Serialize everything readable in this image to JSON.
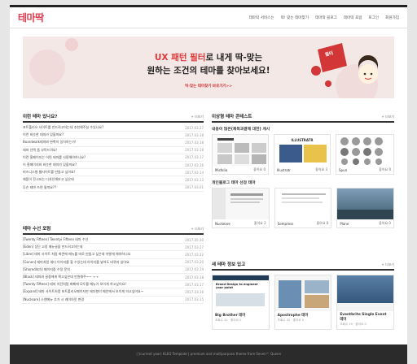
{
  "header": {
    "logo": "테마딱",
    "nav": [
      "테마딱 서비스는",
      "딱! 맞는 테마찾기",
      "테마딱 블로그",
      "테마딱 포럼",
      "로그인",
      "회원가입"
    ]
  },
  "banner": {
    "line1_accent": "UX 패턴 필터",
    "line1_rest": "로 내게 딱-맞는",
    "line2": "원하는 조건의 테마를 찾아보세요!",
    "cta": "딱-맞는 테마찾기 바로가기>>",
    "badge": "필터"
  },
  "faq": {
    "title": "이런 테마 있나요?",
    "more": "+ 더보기",
    "rows": [
      {
        "text": "포트폴리오 사이트를 만드려고하는데 추천해주실 수있나요?",
        "date": "2017.03.27"
      },
      {
        "text": "이런 비슷한 테마가 있을까요?",
        "date": "2017.03.18"
      },
      {
        "text": "Boardwalk테마와 완벽히 일치하는가!",
        "date": "2017.03.18"
      },
      {
        "text": "테마 선택 좀 부탁드려요!",
        "date": "2017.03.18"
      },
      {
        "text": "이런 홈페이지는 어떤 테마를 사용해야하나요?",
        "date": "2017.03.17"
      },
      {
        "text": "이 홈페이지와 비슷한 테마가 있을까요?",
        "date": "2017.03.16"
      },
      {
        "text": "비즈니스형 웹사이트를 만들고 싶어요!",
        "date": "2017.03.14"
      },
      {
        "text": "제품이 전시되는 디자인해보고 싶은데",
        "date": "2017.03.13"
      },
      {
        "text": "무슨 테마 쓰면 될까요??",
        "date": "2017.03.01"
      }
    ]
  },
  "forum": {
    "title": "테마 수선 포럼",
    "more": "+ 더보기",
    "rows": [
      {
        "text": "[Twenty Fifteen] Twentyi Fifteen 테마 수선",
        "date": "2017.05.30"
      },
      {
        "text": "[Eden] 상단 고정 메뉴글을 만드려고하는데",
        "date": "2017.03.27"
      },
      {
        "text": "[Libre] 테마 사이트 처럼 화면에 메뉴를 따로 만들고 싶은데 어떻게 해야하나요",
        "date": "2017.03.22"
      },
      {
        "text": "[Gonen] 테마처럼 헤더 아이지를 할 수있는데 아이지를 넣어도 바뀌지 않아요",
        "date": "2017.03.20"
      },
      {
        "text": "[Shoreditch] 페이지중 수정 문의",
        "date": "2017.03.19"
      },
      {
        "text": "[Blask] 테마와 글중에게 확고싶은데 만원해주~~ ㅜㅜ",
        "date": "2017.03.18"
      },
      {
        "text": "[Twenty Fifteen] 테마 이전처럼 화폐에 모두를 메뉴가 보이게 하고싶어요!",
        "date": "2017.03.17"
      },
      {
        "text": "[Expand] 테마 사이트처럼 포트폴리오페이지만 헤더형이 메인에서 보이게 하고싶어요~",
        "date": "2017.03.16"
      },
      {
        "text": "[Nucleare] 스앤메뉴 추가 시 레이아웃 변경",
        "date": "2017.03.15"
      }
    ]
  },
  "contents": {
    "title": "이상형 테마 콘테스트",
    "more": "+ 더보기",
    "group1_title": "내용이 많은(제목과결해 대한) 게시",
    "group2_title": "개인블로그 테마 선정 테마",
    "group1": [
      {
        "name": "Misfolio",
        "likes": "좋아요 0"
      },
      {
        "name": "Illustratr",
        "likes": "좋아요 3"
      },
      {
        "name": "Spun",
        "likes": "좋아요 0"
      }
    ],
    "group2": [
      {
        "name": "Nuckeare",
        "likes": "좋아요 2"
      },
      {
        "name": "Sempress",
        "likes": "좋아요 0"
      },
      {
        "name": "Plane",
        "likes": "좋아요 0"
      }
    ],
    "thumb_texts": {
      "illustratr": "ILLUSTRATR"
    }
  },
  "news": {
    "title": "새 테마 정보 입고",
    "more": "+ 더보기",
    "items": [
      {
        "name": "Big Brother 테마",
        "meta": "조회수 32 · 좋아요 0"
      },
      {
        "name": "Apostrophe 테마",
        "meta": "조회수 32 · 좋아요 0"
      },
      {
        "name": "Eventbrite Single Event 테마",
        "meta": "조회수 19 · 좋아요 0"
      }
    ],
    "thumb_text": "Brand Design to engineer your point"
  },
  "footer": {
    "text": "ⓒ(current year) KLEO Template | premium and multipurpose theme from Seven™ Queen"
  },
  "colors": {
    "accent": "#e23b4e",
    "banner_bg": "#f4e8e7",
    "footer_bg": "#2b2b2b"
  }
}
